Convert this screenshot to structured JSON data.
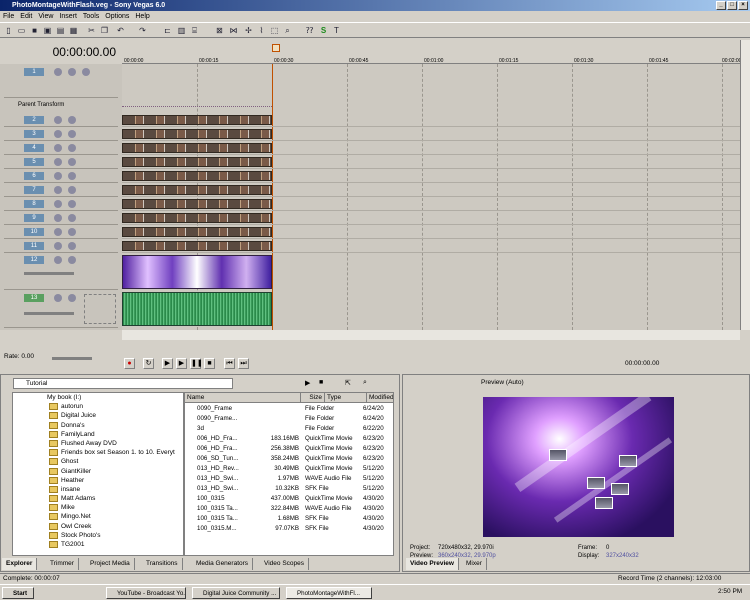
{
  "window": {
    "title": "PhotoMontageWithFlash.veg - Sony Vegas 6.0"
  },
  "menu": [
    "File",
    "Edit",
    "View",
    "Insert",
    "Tools",
    "Options",
    "Help"
  ],
  "timecode": "00:00:00.00",
  "ruler_marks": [
    "00:00:00",
    "00:00:15",
    "00:00:30",
    "00:00:45",
    "00:01:00",
    "00:01:15",
    "00:01:30",
    "00:01:45",
    "00:02:00"
  ],
  "tracks": {
    "parent_label": "Parent Transform",
    "numbers": [
      "1",
      "2",
      "3",
      "4",
      "5",
      "6",
      "7",
      "8",
      "9",
      "10",
      "11",
      "12",
      "13"
    ]
  },
  "rate": "Rate: 0.00",
  "transport_time": "00:00:00.00",
  "explorer": {
    "path": "Tutorial",
    "tree": [
      "My book (I:)",
      "autorun",
      "Digital Juice",
      "Donna's",
      "FamilyLand",
      "Flushed Away DVD",
      "Friends box set Season 1. to 10. Everyt",
      "Ghost",
      "GiantKiller",
      "Heather",
      "insane",
      "Matt Adams",
      "Mike",
      "Mingo.Net",
      "Owl Creek",
      "Stock Photo's",
      "TG2001"
    ],
    "columns": [
      "Name",
      "Size",
      "Type",
      "Modified"
    ],
    "files": [
      {
        "name": "0090_Frame",
        "size": "",
        "type": "File Folder",
        "modified": "6/24/20"
      },
      {
        "name": "0090_Frame...",
        "size": "",
        "type": "File Folder",
        "modified": "6/24/20"
      },
      {
        "name": "3d",
        "size": "",
        "type": "File Folder",
        "modified": "6/22/20"
      },
      {
        "name": "006_HD_Fra...",
        "size": "183.16MB",
        "type": "QuickTime Movie",
        "modified": "6/23/20"
      },
      {
        "name": "006_HD_Fra...",
        "size": "256.38MB",
        "type": "QuickTime Movie",
        "modified": "6/23/20"
      },
      {
        "name": "006_SD_Tun...",
        "size": "358.24MB",
        "type": "QuickTime Movie",
        "modified": "6/23/20"
      },
      {
        "name": "013_HD_Rev...",
        "size": "30.49MB",
        "type": "QuickTime Movie",
        "modified": "5/12/20"
      },
      {
        "name": "013_HD_Swi...",
        "size": "1.97MB",
        "type": "WAVE Audio File",
        "modified": "5/12/20"
      },
      {
        "name": "013_HD_Swi...",
        "size": "10.32KB",
        "type": "SFK File",
        "modified": "5/12/20"
      },
      {
        "name": "100_0315",
        "size": "437.00MB",
        "type": "QuickTime Movie",
        "modified": "4/30/20"
      },
      {
        "name": "100_0315 Ta...",
        "size": "322.84MB",
        "type": "WAVE Audio File",
        "modified": "4/30/20"
      },
      {
        "name": "100_0315 Ta...",
        "size": "1.68MB",
        "type": "SFK File",
        "modified": "4/30/20"
      },
      {
        "name": "100_0315.M...",
        "size": "97.07KB",
        "type": "SFK File",
        "modified": "4/30/20"
      }
    ],
    "tabs": [
      "Explorer",
      "Trimmer",
      "Project Media",
      "Transitions",
      "Media Generators",
      "Video Scopes"
    ]
  },
  "preview": {
    "mode": "Preview (Auto)",
    "project_label": "Project:",
    "project": "720x480x32, 29.970i",
    "preview_label": "Preview:",
    "preview": "360x240x32, 29.970p",
    "frame_label": "Frame:",
    "frame": "0",
    "display_label": "Display:",
    "display": "327x240x32",
    "tabs": [
      "Video Preview",
      "Mixer"
    ]
  },
  "status": {
    "left": "Complete: 00:00:07",
    "right": "Record Time (2 channels): 12:03:00"
  },
  "taskbar": {
    "start": "Start",
    "tasks": [
      "YouTube - Broadcast Yo...",
      "Digital Juice Community ...",
      "PhotoMontageWithFl..."
    ],
    "clock": "2:50 PM"
  }
}
